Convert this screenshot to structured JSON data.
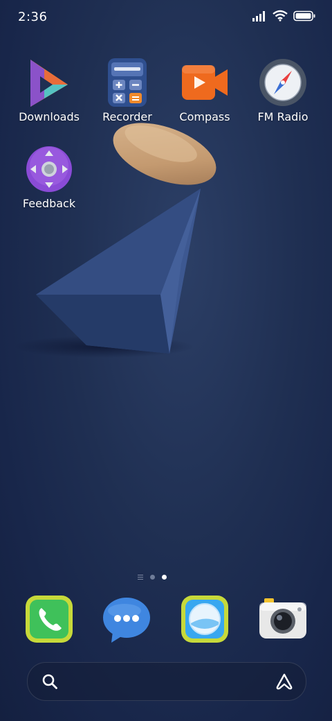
{
  "status_bar": {
    "time": "2:36",
    "icons": [
      "signal-icon",
      "wifi-icon",
      "battery-icon"
    ]
  },
  "apps": [
    {
      "label": "Downloads",
      "icon": "downloads-icon"
    },
    {
      "label": "Recorder",
      "icon": "recorder-icon"
    },
    {
      "label": "Compass",
      "icon": "compass-icon"
    },
    {
      "label": "FM Radio",
      "icon": "fm-radio-icon"
    },
    {
      "label": "Feedback",
      "icon": "feedback-icon"
    }
  ],
  "page_indicator": {
    "pages": 2,
    "current": 2
  },
  "dock": [
    {
      "icon": "phone-icon"
    },
    {
      "icon": "messages-icon"
    },
    {
      "icon": "browser-icon"
    },
    {
      "icon": "camera-icon"
    }
  ],
  "search_bar": {
    "icons": [
      "search-icon",
      "assistant-icon"
    ]
  },
  "colors": {
    "background": "#1f2f52",
    "downloads_orange": "#f08a2c",
    "recorder_blue": "#2f4f8f",
    "compass_orange": "#ef6a1e",
    "radio_gray": "#4a5566",
    "feedback_purple": "#8a4bd6",
    "phone_green": "#3fc15a",
    "message_blue": "#3f86e0",
    "browser_blue": "#38a7f0",
    "camera_white": "#e8e8e8"
  }
}
